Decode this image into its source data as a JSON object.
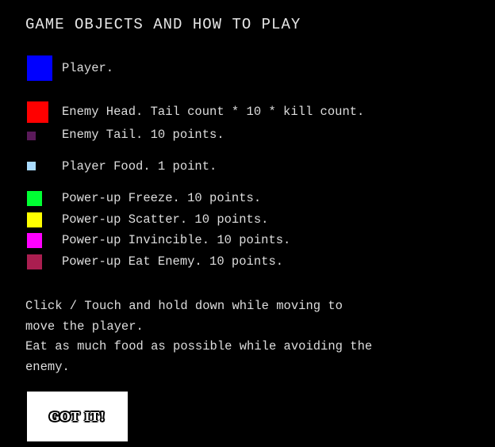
{
  "title": "GAME OBJECTS AND HOW TO PLAY",
  "legend": [
    {
      "label": "Player.",
      "color": "#0000ff",
      "icon": "player-square"
    },
    {
      "label": "Enemy Head. Tail count * 10 * kill count.",
      "color": "#ff0000",
      "icon": "enemy-head-square"
    },
    {
      "label": "Enemy Tail. 10 points.",
      "color": "#5a1a5a",
      "icon": "enemy-tail-square"
    },
    {
      "label": "Player Food. 1 point.",
      "color": "#aadcff",
      "icon": "food-square"
    },
    {
      "label": "Power-up Freeze. 10 points.",
      "color": "#00ff33",
      "icon": "freeze-square"
    },
    {
      "label": "Power-up Scatter. 10 points.",
      "color": "#ffff00",
      "icon": "scatter-square"
    },
    {
      "label": "Power-up Invincible. 10 points.",
      "color": "#ff00ff",
      "icon": "invincible-square"
    },
    {
      "label": "Power-up Eat Enemy. 10 points.",
      "color": "#aa1e50",
      "icon": "eat-enemy-square"
    }
  ],
  "instructions": [
    "Click / Touch and hold down while moving to",
    "move the player.",
    "Eat as much food as possible while avoiding the",
    "enemy."
  ],
  "button_label": "GOT IT!"
}
